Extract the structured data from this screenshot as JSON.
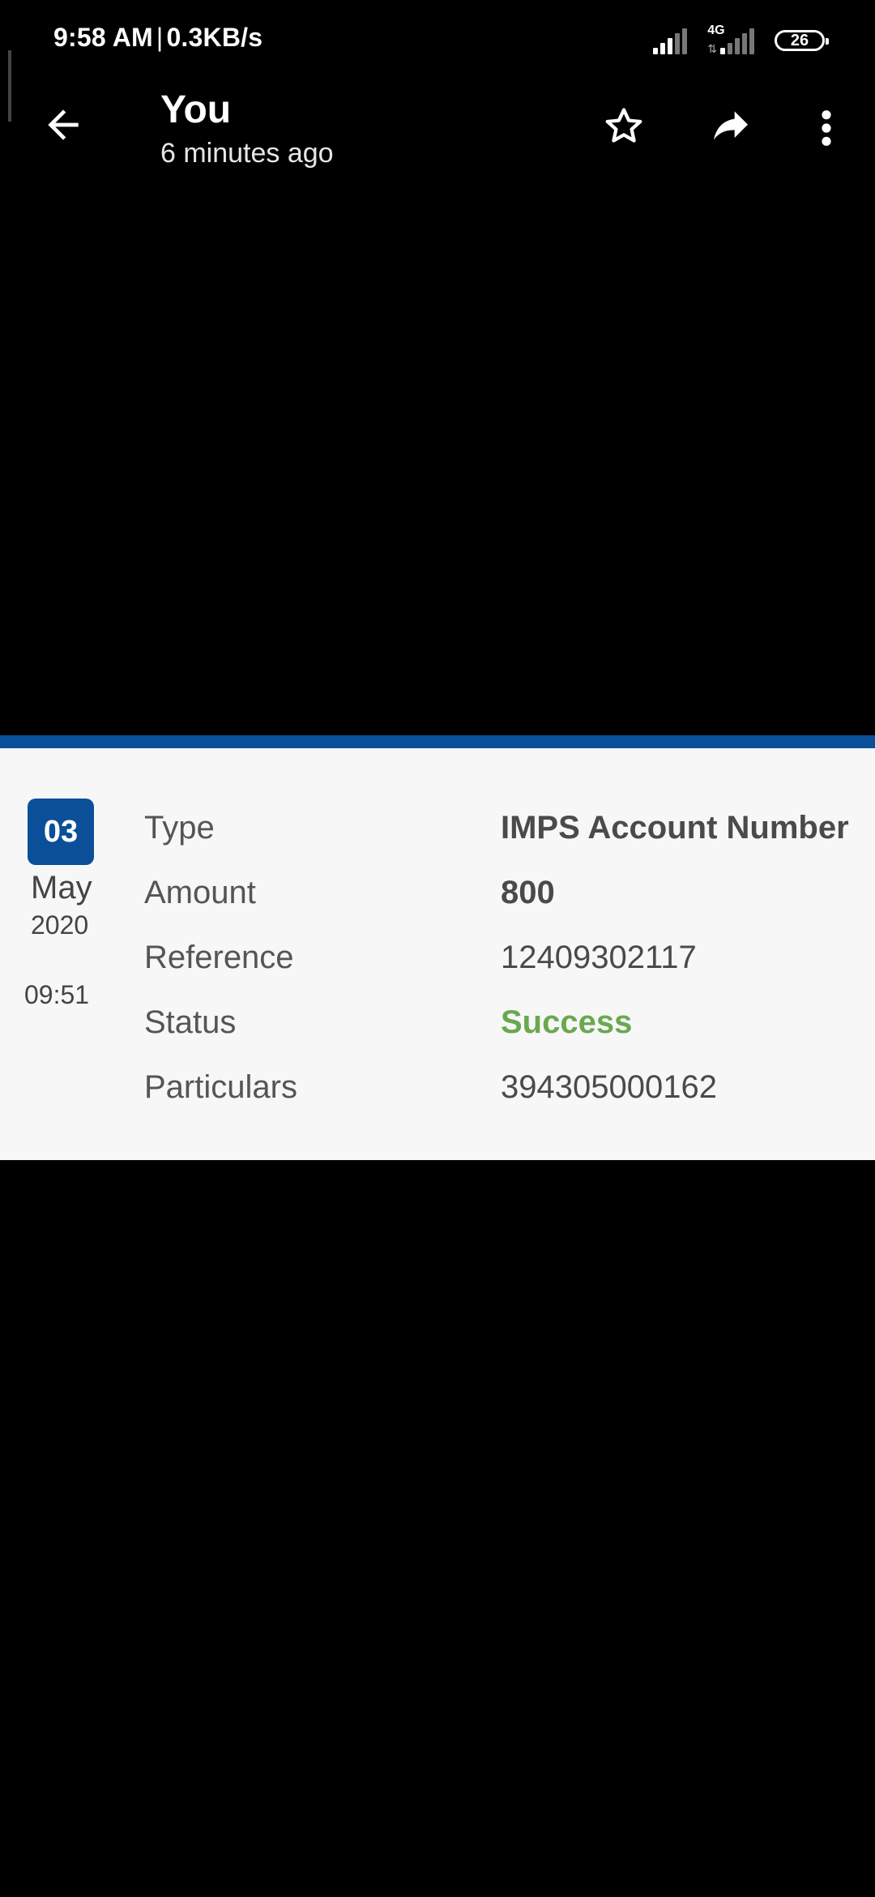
{
  "status_bar": {
    "time": "9:58 AM",
    "separator": "|",
    "speed": "0.3KB/s",
    "network_label": "4G",
    "battery": "26"
  },
  "app_bar": {
    "title": "You",
    "subtitle": "6 minutes ago",
    "icons": [
      "back-arrow-icon",
      "star-icon",
      "share-icon",
      "more-vert-icon"
    ]
  },
  "transaction": {
    "date": {
      "day": "03",
      "month": "May",
      "year": "2020",
      "time": "09:51"
    },
    "rows": [
      {
        "label": "Type",
        "value": "IMPS Account Number"
      },
      {
        "label": "Amount",
        "value": "800"
      },
      {
        "label": "Reference",
        "value": "12409302117"
      },
      {
        "label": "Status",
        "value": "Success"
      },
      {
        "label": "Particulars",
        "value": "394305000162"
      }
    ]
  },
  "colors": {
    "accent_blue": "#0b4f98",
    "success_green": "#6aa84f",
    "card_background": "#f7f7f7",
    "screen_background": "#000000"
  }
}
